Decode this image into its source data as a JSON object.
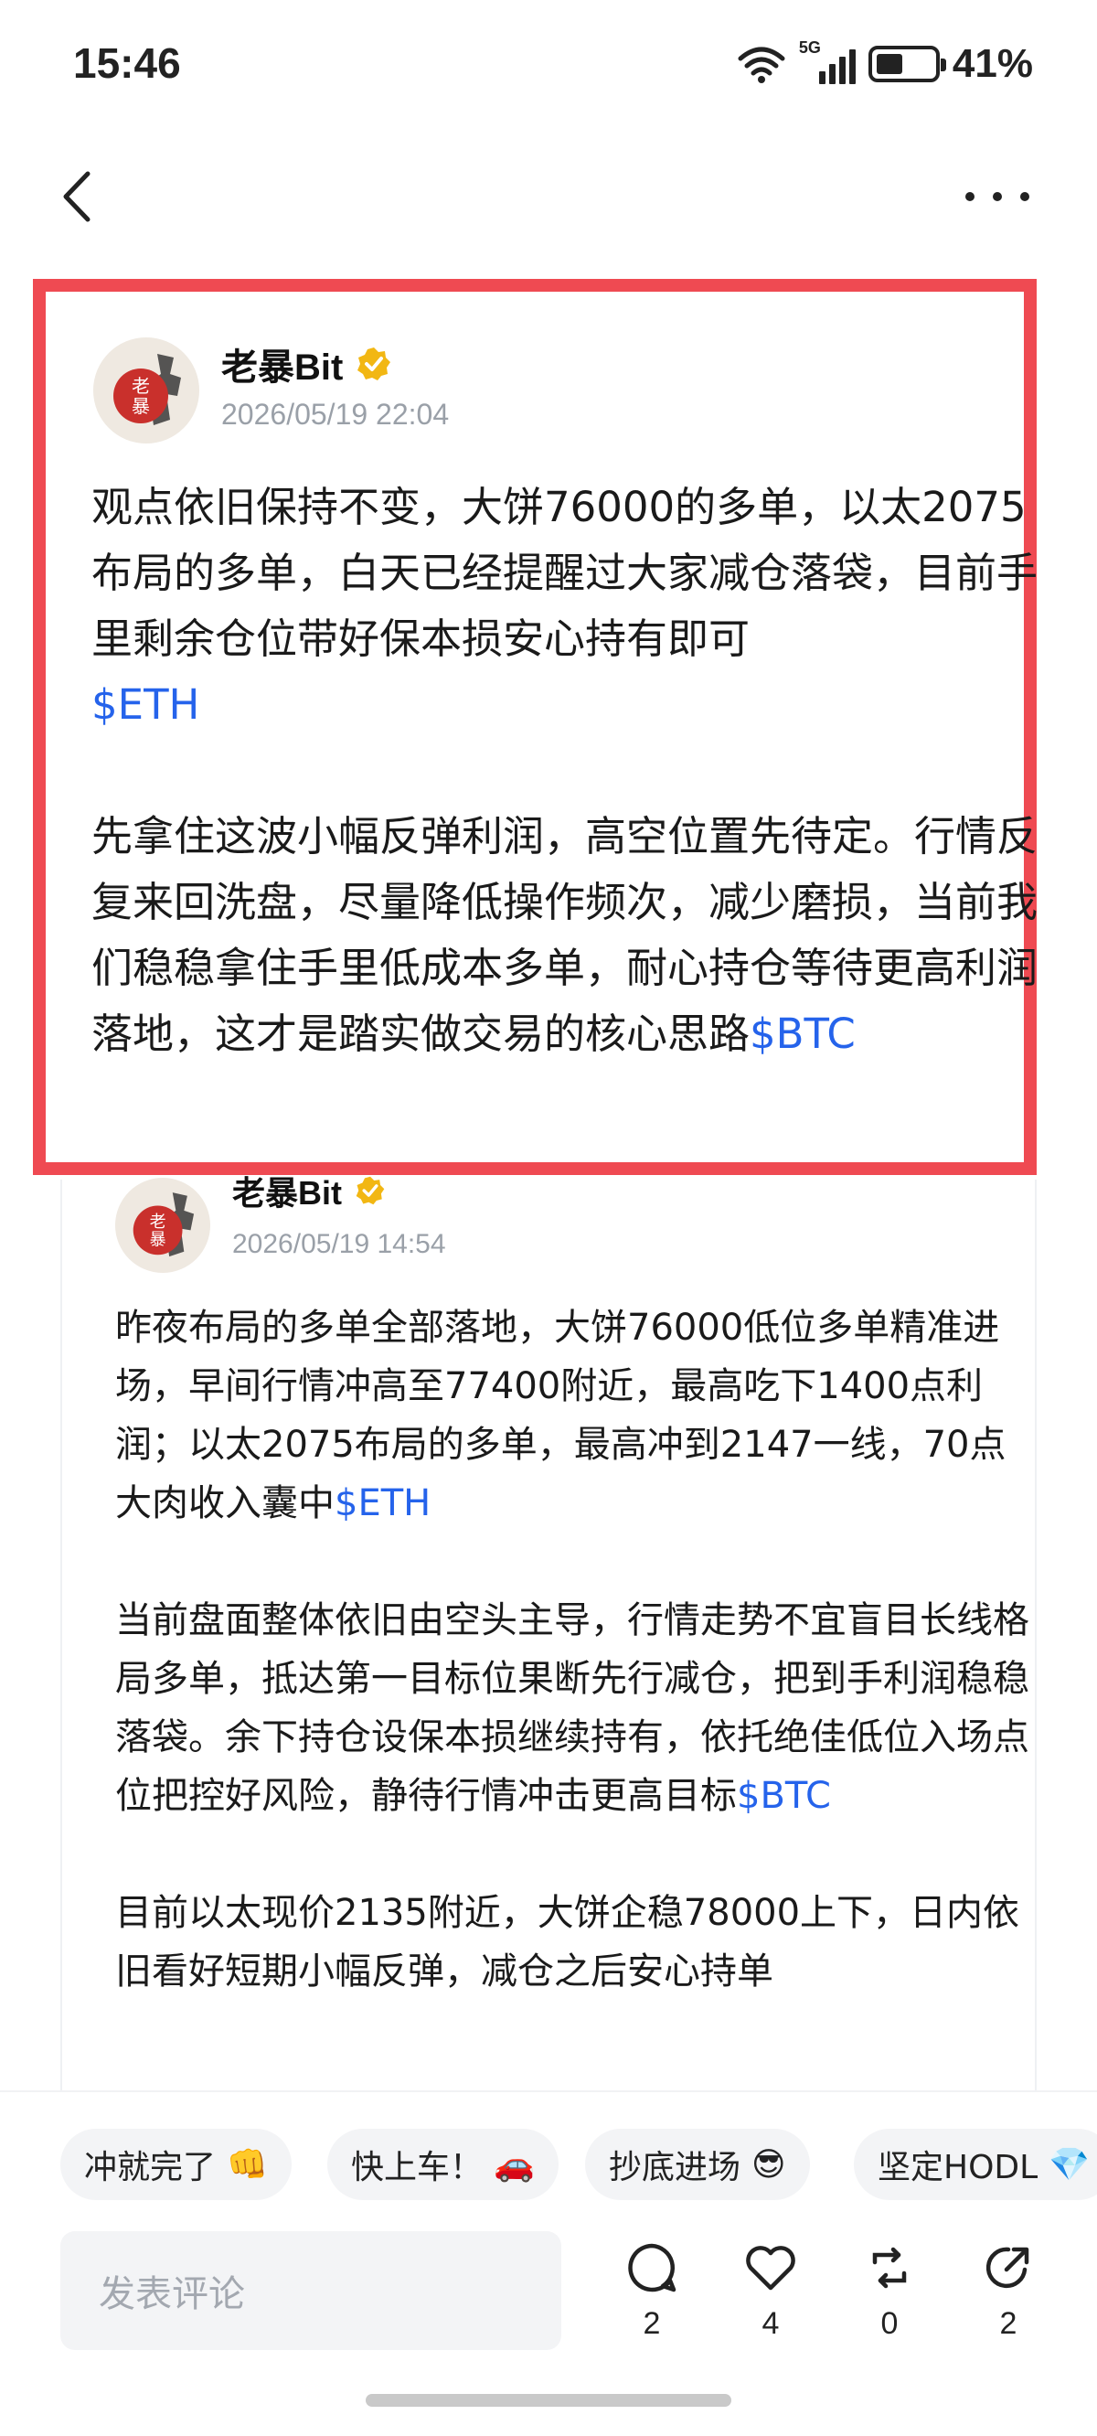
{
  "status_bar": {
    "time": "15:46",
    "network": "5G",
    "battery": "41%",
    "battery_level": 0.41
  },
  "nav": {
    "back_icon": "chevron-left-icon",
    "more_icon": "more-horizontal-icon"
  },
  "highlight_color": "#ef4a52",
  "accent_color": "#2563eb",
  "post1": {
    "author": "老暴Bit",
    "avatar_text": "老暴",
    "time": "2026/05/19 22:04",
    "para1": "观点依旧保持不变，大饼76000的多单，以太2075布局的多单，白天已经提醒过大家减仓落袋，目前手里剩余仓位带好保本损安心持有即可",
    "tag1": "$ETH",
    "para2": "先拿住这波小幅反弹利润，高空位置先待定。行情反复来回洗盘，尽量降低操作频次，减少磨损，当前我们稳稳拿住手里低成本多单，耐心持仓等待更高利润落地，这才是踏实做交易的核心思路",
    "tag2": "$BTC"
  },
  "post2": {
    "author": "老暴Bit",
    "avatar_text": "老暴",
    "time": "2026/05/19 14:54",
    "para1": "昨夜布局的多单全部落地，大饼76000低位多单精准进场，早间行情冲高至77400附近，最高吃下1400点利润；以太2075布局的多单，最高冲到2147一线，70点大肉收入囊中",
    "tag1": "$ETH",
    "para2": "当前盘面整体依旧由空头主导，行情走势不宜盲目长线格局多单，抵达第一目标位果断先行减仓，把到手利润稳稳落袋。余下持仓设保本损继续持有，依托绝佳低位入场点位把控好风险，静待行情冲击更高目标",
    "tag2": "$BTC",
    "para3": "目前以太现价2135附近，大饼企稳78000上下，日内依旧看好短期小幅反弹，减仓之后安心持单"
  },
  "reactions": [
    {
      "label": "冲就完了",
      "emoji": "👊"
    },
    {
      "label": "快上车！",
      "emoji": "🚗"
    },
    {
      "label": "抄底进场",
      "emoji": "😎"
    },
    {
      "label": "坚定HODL",
      "emoji": "💎"
    }
  ],
  "comment": {
    "placeholder": "发表评论"
  },
  "actions": {
    "comments": "2",
    "likes": "4",
    "reposts": "0",
    "shares": "2"
  }
}
